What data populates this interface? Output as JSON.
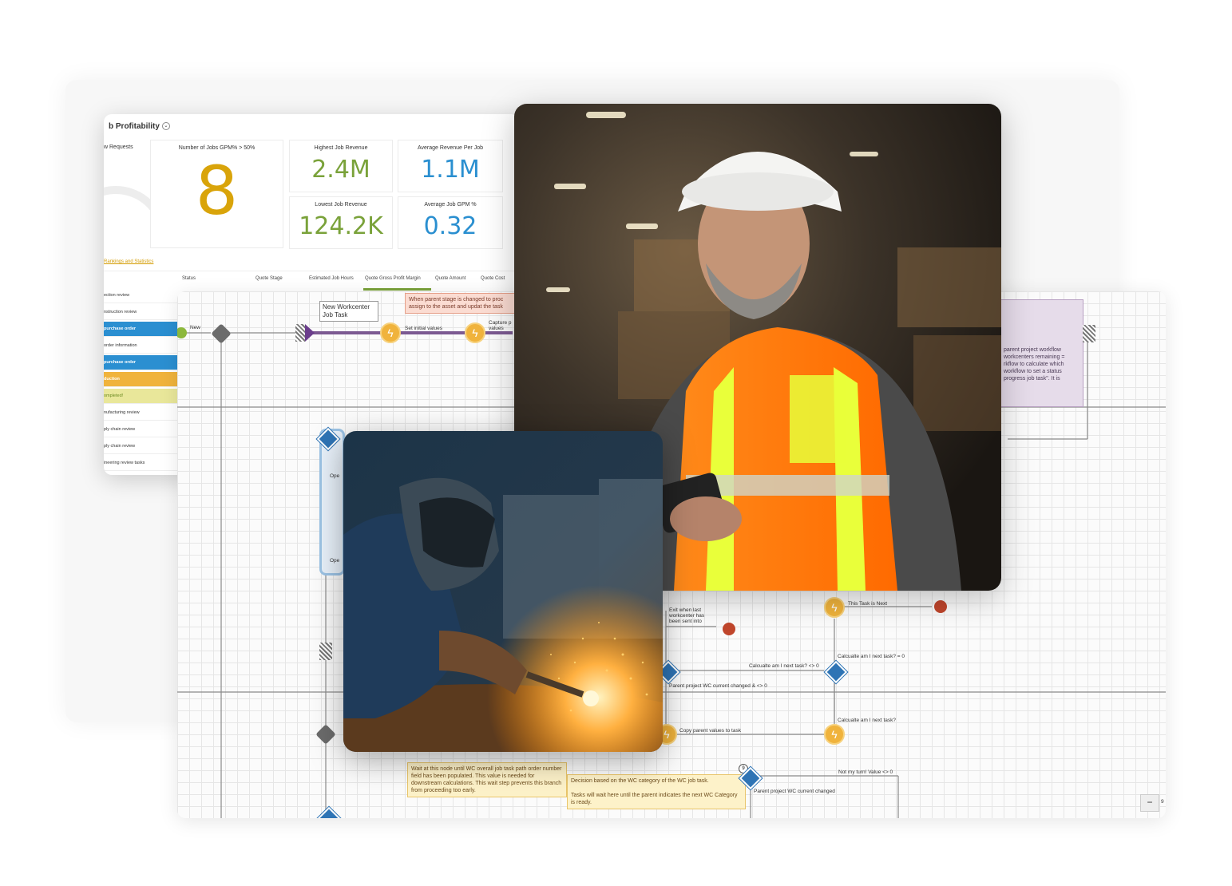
{
  "dashboard": {
    "title": "b Profitability",
    "kpis": [
      {
        "label": "w Requests",
        "value": ""
      },
      {
        "label": "Number of Jobs GPM% > 50%",
        "value": "8"
      },
      {
        "label": "Highest Job Revenue",
        "value": "2.4M"
      },
      {
        "label": "Average Revenue Per Job",
        "value": "1.1M"
      },
      {
        "label": "Lowest Job Revenue",
        "value": "124.2K"
      },
      {
        "label": "Average Job GPM %",
        "value": "0.32"
      }
    ],
    "stats_link": "Rankings and Statistics",
    "columns": [
      "Status",
      "Quote Stage",
      "Estimated Job Hours",
      "Quote Gross Profit Margin",
      "Quote Amount",
      "Quote Cost"
    ],
    "rows": [
      "ection review",
      "nstruction review",
      "purchase order",
      "order information",
      "purchase order",
      "duction",
      "ompleted!",
      "nufacturing review",
      "ply chain review",
      "ply chain review",
      "ineering review tasks"
    ],
    "colors": {
      "kpi_orange": "#d9a40a",
      "kpi_green": "#7aa23a",
      "kpi_blue": "#2a8fd0"
    }
  },
  "workflow": {
    "new_label": "New",
    "task_box": "New Workcenter Job Task",
    "set_initial": "Set initial values",
    "capture": "Capture p values",
    "note_parent_stage": "When parent stage is changed to proc assign to the asset and updat the task",
    "note_right": "parent project workflow workcenters remaining = rkflow to calculate which workflow to set a status progress job task\". It is",
    "open_1": "Ope",
    "open_2": "Ope",
    "exit_last": "Exit when last workcenter has been sent into",
    "this_task_next": "This Task is Next",
    "calc_next_ne": "Calcualte am I next task? <> 0",
    "calc_next_eq": "Calcualte am I next task? = 0",
    "parent_changed": "Parent project WC current changed & <> 0",
    "calc_next_q": "Calcualte am I next task?",
    "copy_parent": "Copy parent values to task",
    "note_wait": "Wait at this node until WC overall job task path order number field has been populated. This value is needed for downstream calculations. This wait step prevents this branch from proceeding too early.",
    "note_decision": "Decision based on the WC category of the WC job task.\n\nTasks will wait here until the parent indicates the next WC Category is ready.",
    "not_my_turn": "Not my turn! Value <> 0",
    "parent_wc_changed": "Parent project WC current changed",
    "zoom_minus": "−",
    "zoom_value": "9"
  },
  "photos": {
    "worker_alt": "Smiling worker in hard hat and safety vest holding a tablet in a warehouse",
    "welder_alt": "Welder wearing a mask with sparks flying"
  }
}
